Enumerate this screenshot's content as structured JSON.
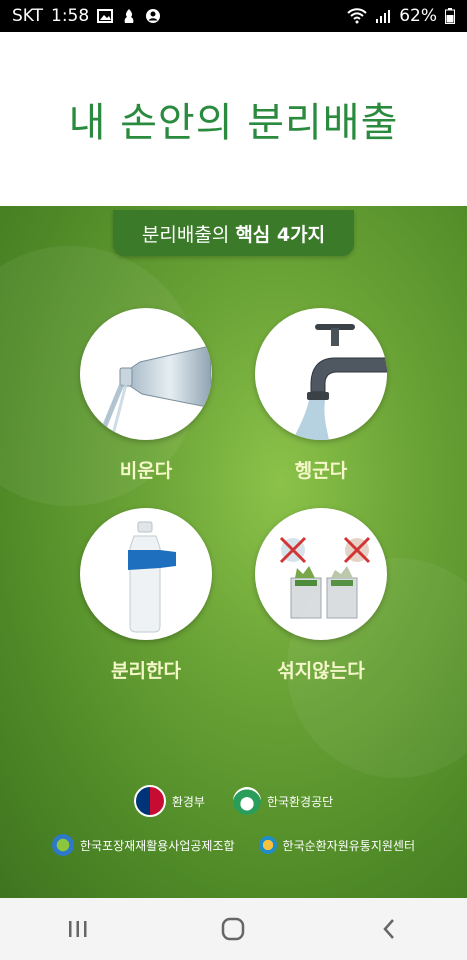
{
  "status_bar": {
    "carrier": "SKT",
    "time": "1:58",
    "battery": "62%",
    "icons_left": [
      "image-icon",
      "notification-icon",
      "account-icon"
    ],
    "icons_right": [
      "wifi-icon",
      "signal-icon",
      "battery-icon"
    ]
  },
  "header": {
    "title": "내 손안의 분리배출"
  },
  "main": {
    "badge_prefix": "분리배출의",
    "badge_bold": "핵심 4가지",
    "steps": [
      {
        "label": "비운다",
        "icon": "pouring-bottle-icon"
      },
      {
        "label": "헹군다",
        "icon": "faucet-icon"
      },
      {
        "label": "분리한다",
        "icon": "bottle-label-icon"
      },
      {
        "label": "섞지않는다",
        "icon": "recycle-bins-icon"
      }
    ],
    "logos": {
      "row1": [
        "환경부",
        "한국환경공단"
      ],
      "row2": [
        "한국포장재재활용사업공제조합",
        "한국순환자원유통지원센터"
      ]
    }
  },
  "colors": {
    "title_green": "#2a8a3e",
    "badge_green": "#3a7a28",
    "label_yellow": "#f4f7c7"
  },
  "nav": [
    "recent-apps-button",
    "home-button",
    "back-button"
  ]
}
